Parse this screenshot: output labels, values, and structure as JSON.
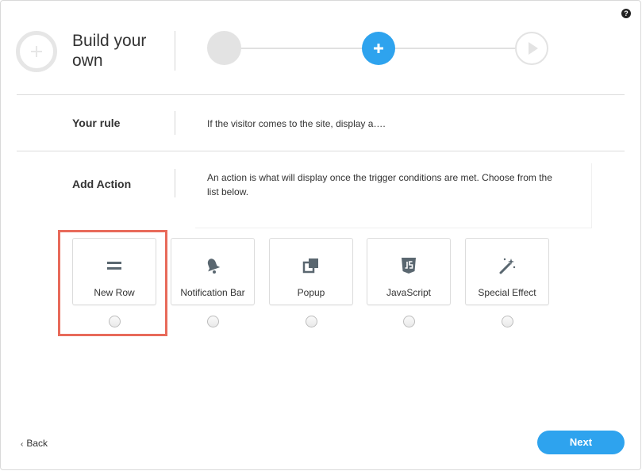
{
  "header": {
    "title": "Build your own",
    "help_glyph": "?"
  },
  "stepper": {
    "steps": [
      {
        "state": "complete",
        "icon": ""
      },
      {
        "state": "active",
        "icon": "plus-icon"
      },
      {
        "state": "upcoming",
        "icon": "play-icon"
      }
    ]
  },
  "rule": {
    "label": "Your rule",
    "text": "If the visitor comes to the site, display a…."
  },
  "action": {
    "label": "Add Action",
    "text": "An action is what will display once the trigger conditions are met. Choose from the list below."
  },
  "options": [
    {
      "label": "New Row",
      "icon": "equals-icon",
      "highlighted": true
    },
    {
      "label": "Notification Bar",
      "icon": "bell-icon",
      "highlighted": false
    },
    {
      "label": "Popup",
      "icon": "popup-icon",
      "highlighted": false
    },
    {
      "label": "JavaScript",
      "icon": "js-icon",
      "highlighted": false
    },
    {
      "label": "Special Effect",
      "icon": "magic-wand-icon",
      "highlighted": false
    }
  ],
  "footer": {
    "back_label": "Back",
    "next_label": "Next"
  },
  "colors": {
    "accent": "#2ea3ee",
    "highlight": "#e86a5a",
    "icon": "#5a6770"
  }
}
